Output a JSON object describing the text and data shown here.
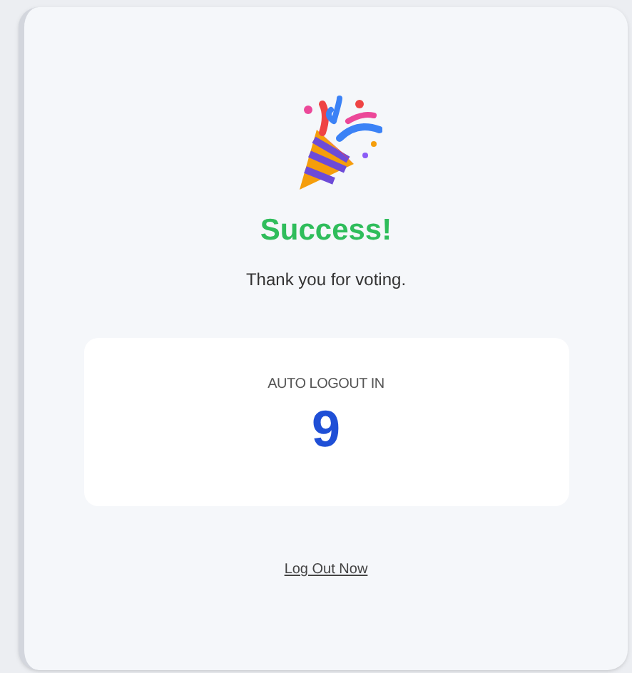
{
  "title": "Success!",
  "message": "Thank you for voting.",
  "countdown": {
    "label": "AUTO LOGOUT IN",
    "value": "9"
  },
  "logout_link": "Log Out Now"
}
